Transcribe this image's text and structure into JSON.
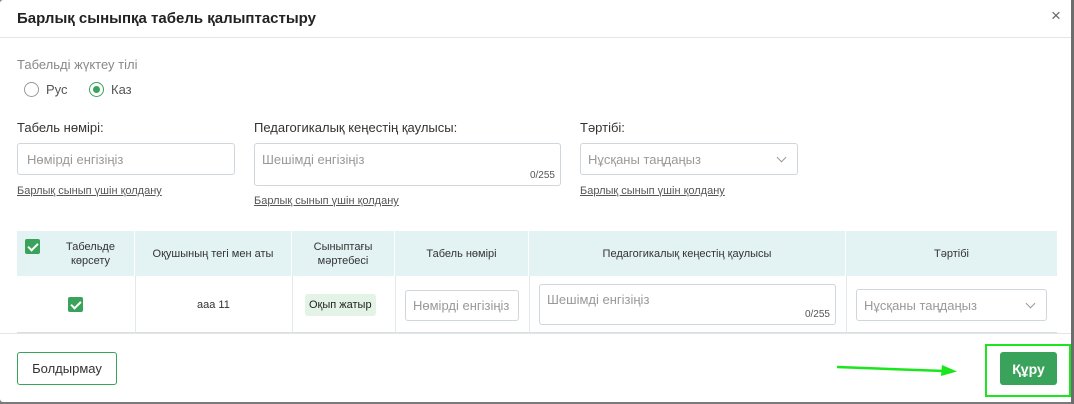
{
  "dialog": {
    "title": "Барлық сыныпқа табель қалыптастыру",
    "close_symbol": "×"
  },
  "language": {
    "label": "Табельді жүктеу тілі",
    "options": [
      {
        "label": "Рус",
        "checked": false
      },
      {
        "label": "Каз",
        "checked": true
      }
    ]
  },
  "fields": {
    "number_label": "Табель нөмірі:",
    "number_placeholder": "Нөмірді енгізіңіз",
    "council_label": "Педагогикалық кеңестің қаулысы:",
    "council_placeholder": "Шешімді енгізіңіз",
    "council_counter": "0/255",
    "order_label": "Тәртібі:",
    "order_placeholder": "Нұсқаны таңдаңыз",
    "apply_all": "Барлық сынып үшін қолдану"
  },
  "table": {
    "columns": [
      "Табельде көрсету",
      "Оқушының тегі мен аты",
      "Сыныптағы мәртебесі",
      "Табель нөмірі",
      "Педагогикалық кеңестің қаулысы",
      "Тәртібі"
    ],
    "rows": [
      {
        "name": "ааа 11",
        "status": "Оқып жатыр",
        "number_placeholder": "Нөмірді енгізіңіз",
        "council_placeholder": "Шешімді енгізіңіз",
        "council_counter": "0/255",
        "order_placeholder": "Нұсқаны таңдаңыз"
      }
    ]
  },
  "footer": {
    "cancel_label": "Болдырмау",
    "create_label": "Құру"
  },
  "colors": {
    "accent": "#3aa35b",
    "header_bg": "#e3f2f3",
    "highlight": "#19e61c"
  }
}
